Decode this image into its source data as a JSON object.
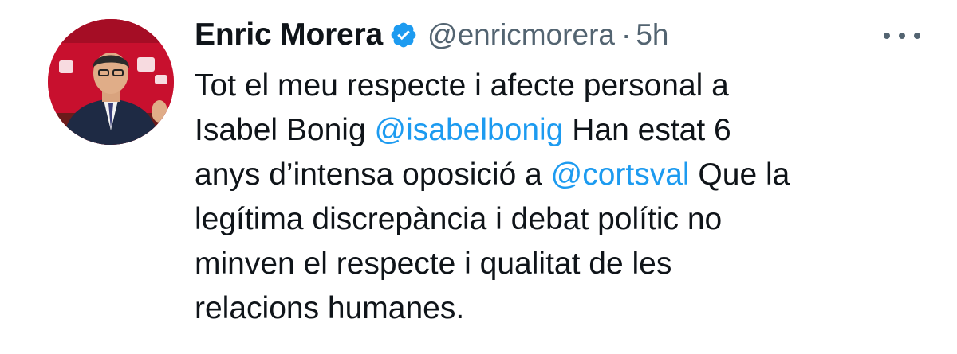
{
  "tweet": {
    "author": {
      "display_name": "Enric Morera",
      "handle": "@enricmorera",
      "verified": true,
      "avatar_icon": "profile-photo"
    },
    "separator": "·",
    "timestamp": "5h",
    "more_icon": "ellipsis-icon",
    "text_lines": [
      [
        "Tot el meu respecte i afecte personal a"
      ],
      [
        "Isabel Bonig ",
        "@isabelbonig",
        " Han estat 6"
      ],
      [
        "anys d’intensa oposició a ",
        "@cortsval",
        " Que la"
      ],
      [
        "legítima discrepància i debat polític no"
      ],
      [
        "minven el respecte i qualitat de les"
      ],
      [
        "relacions humanes."
      ]
    ],
    "mentions": [
      "@isabelbonig",
      "@cortsval"
    ]
  },
  "colors": {
    "text": "#0f1419",
    "secondary": "#536471",
    "link": "#1d9bf0",
    "verified": "#1d9bf0",
    "avatar_background": "#c8102e"
  }
}
